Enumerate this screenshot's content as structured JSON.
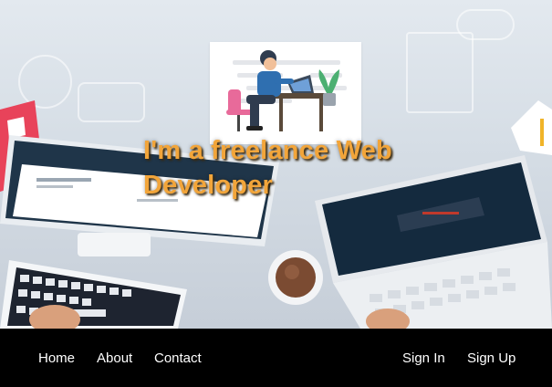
{
  "hero": {
    "headline_line1": "I'm a freelance Web",
    "headline_line2": "Developer",
    "illustration": "developer-at-desk-icon"
  },
  "nav": {
    "left": [
      "Home",
      "About",
      "Contact"
    ],
    "right": [
      "Sign In",
      "Sign Up"
    ]
  },
  "colors": {
    "headline": "#f2a53a",
    "navbar_bg": "#000000",
    "nav_text": "#ffffff"
  }
}
